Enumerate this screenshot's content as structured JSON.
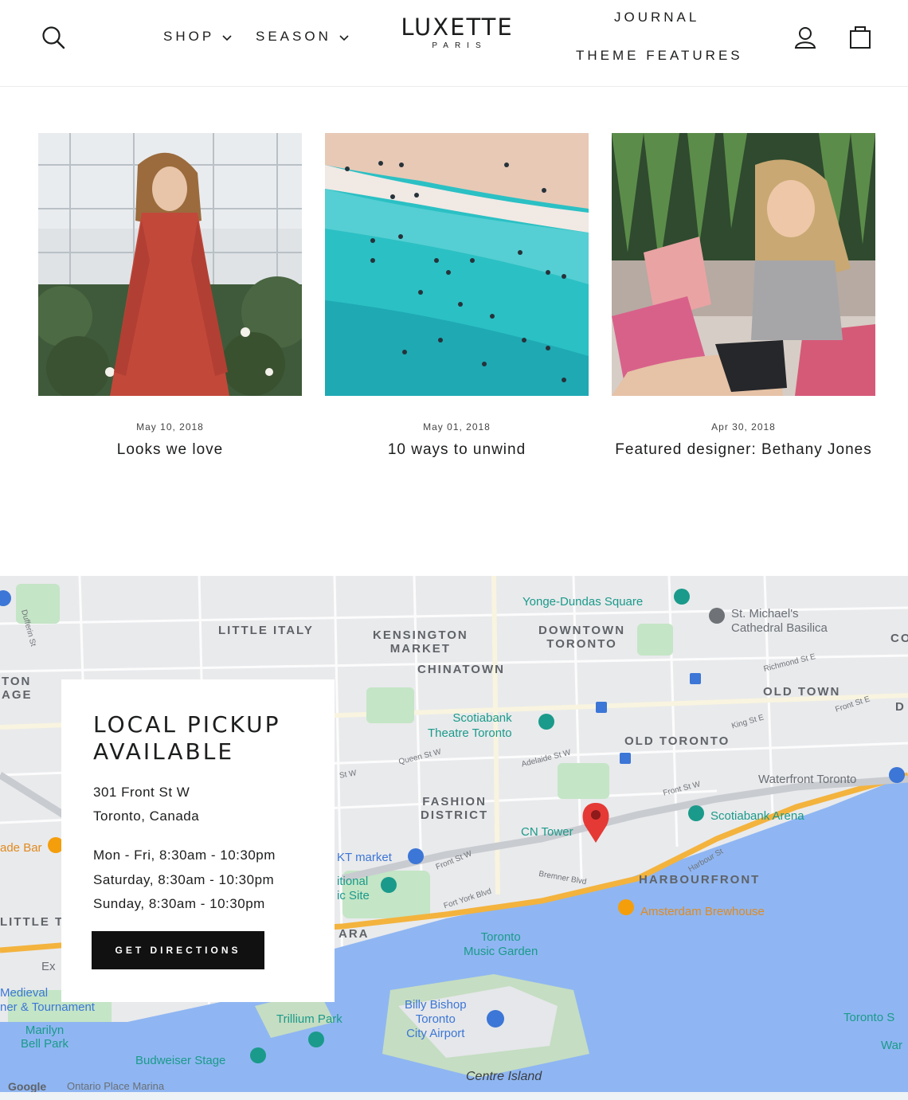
{
  "header": {
    "nav_left": [
      {
        "label": "SHOP",
        "has_dropdown": true
      },
      {
        "label": "SEASON",
        "has_dropdown": true
      }
    ],
    "logo": {
      "main": "LUXETTE",
      "sub": "PARIS"
    },
    "nav_right": [
      {
        "label": "JOURNAL"
      },
      {
        "label": "THEME FEATURES"
      }
    ],
    "icons": [
      "search-icon",
      "account-icon",
      "cart-icon"
    ]
  },
  "articles": [
    {
      "date": "May 10, 2018",
      "title": "Looks we love",
      "image": "woman in red dress in greenhouse"
    },
    {
      "date": "May 01, 2018",
      "title": "10 ways to unwind",
      "image": "aerial beach with swimmers"
    },
    {
      "date": "Apr 30, 2018",
      "title": "Featured designer: Bethany Jones",
      "image": "woman relaxing on patterned cushions"
    }
  ],
  "pickup": {
    "title_line1": "LOCAL PICKUP",
    "title_line2": "AVAILABLE",
    "address_line1": "301 Front St W",
    "address_line2": "Toronto, Canada",
    "hours": [
      "Mon - Fri, 8:30am - 10:30pm",
      "Saturday, 8:30am - 10:30pm",
      "Sunday, 8:30am - 10:30pm"
    ],
    "button_label": "GET DIRECTIONS"
  },
  "map": {
    "districts": {
      "little_italy": "LITTLE ITALY",
      "kensington": "KENSINGTON\nMARKET",
      "downtown": "DOWNTOWN\nTORONTO",
      "chinatown": "CHINATOWN",
      "old_town": "OLD TOWN",
      "old_toronto": "OLD TORONTO",
      "fashion": "FASHION\nDISTRICT",
      "harbourfront": "HARBOURFRONT",
      "edge_ton": "TON\nAGE",
      "edge_little": "LITTLE T",
      "edge_ara": "ARA",
      "edge_co": "CO",
      "edge_d": "D"
    },
    "pois": {
      "yonge_dundas": "Yonge-Dundas Square",
      "st_michaels": "St. Michael's\nCathedral Basilica",
      "scotiabank_theatre": "Scotiabank\nTheatre Toronto",
      "waterfront": "Waterfront Toronto",
      "cn_tower": "CN Tower",
      "scotiabank_arena": "Scotiabank Arena",
      "kt_market": "KT market",
      "national_site": "itional\nic Site",
      "amsterdam": "Amsterdam Brewhouse",
      "music_garden": "Toronto\nMusic Garden",
      "billy_bishop": "Billy Bishop\nToronto\nCity Airport",
      "trillium": "Trillium Park",
      "budweiser": "Budweiser Stage",
      "marilyn": "Marilyn\nBell Park",
      "medieval": "Medieval\nner & Tournament",
      "ade_bar": "ade Bar",
      "ontario_place": "Ontario Place Marina",
      "centre_island": "Centre Island",
      "toronto_s": "Toronto S",
      "war": "War",
      "exh": "Ex"
    },
    "streets": {
      "queen": "Queen St W",
      "adelaide": "Adelaide St W",
      "king": "King St E",
      "front_e": "Front St E",
      "richmond": "Richmond St E",
      "front_w": "Front St W",
      "front_w2": "Front St W",
      "bremner": "Bremner Blvd",
      "harbour": "Harbour St",
      "fort_york": "Fort York Blvd",
      "dufferin": "Dufferin St",
      "st_w": "St W"
    },
    "attribution": "Google"
  }
}
